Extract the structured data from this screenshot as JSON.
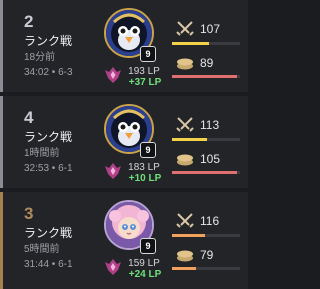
{
  "matches": [
    {
      "placement": "2",
      "mode": "ランク戦",
      "time_ago": "18分前",
      "duration_meta": "34:02 • 6-3",
      "level": "9",
      "lp": "193 LP",
      "lp_change": "+37 LP",
      "damage": "107",
      "gold": "89",
      "avatar_icon": "penguin-avatar-icon",
      "colors": {
        "placement": "#c9ccd3",
        "accent": "#8a8d93",
        "damage_bar": "#f2d14b",
        "gold_bar": "#e06f6f"
      }
    },
    {
      "placement": "4",
      "mode": "ランク戦",
      "time_ago": "1時間前",
      "duration_meta": "32:53 • 6-1",
      "level": "9",
      "lp": "183 LP",
      "lp_change": "+10 LP",
      "damage": "113",
      "gold": "105",
      "avatar_icon": "penguin-avatar-icon",
      "colors": {
        "placement": "#c9ccd3",
        "accent": "#8a8d93",
        "damage_bar": "#f2d14b",
        "gold_bar": "#e06f6f"
      }
    },
    {
      "placement": "3",
      "mode": "ランク戦",
      "time_ago": "5時間前",
      "duration_meta": "31:44 • 6-1",
      "level": "9",
      "lp": "159 LP",
      "lp_change": "+24 LP",
      "damage": "116",
      "gold": "79",
      "avatar_icon": "pink-hair-avatar-icon",
      "colors": {
        "placement": "#b08a5a",
        "accent": "#a5814f",
        "damage_bar": "#f0a15c",
        "gold_bar": "#f0a15c"
      }
    }
  ],
  "icons": {
    "rank": "rank-emblem-icon",
    "damage": "crossed-swords-icon",
    "gold": "gold-coins-icon"
  },
  "stats": {
    "damage_fill": [
      0.55,
      0.52,
      0.48
    ],
    "gold_fill": [
      0.95,
      0.95,
      0.35
    ]
  }
}
